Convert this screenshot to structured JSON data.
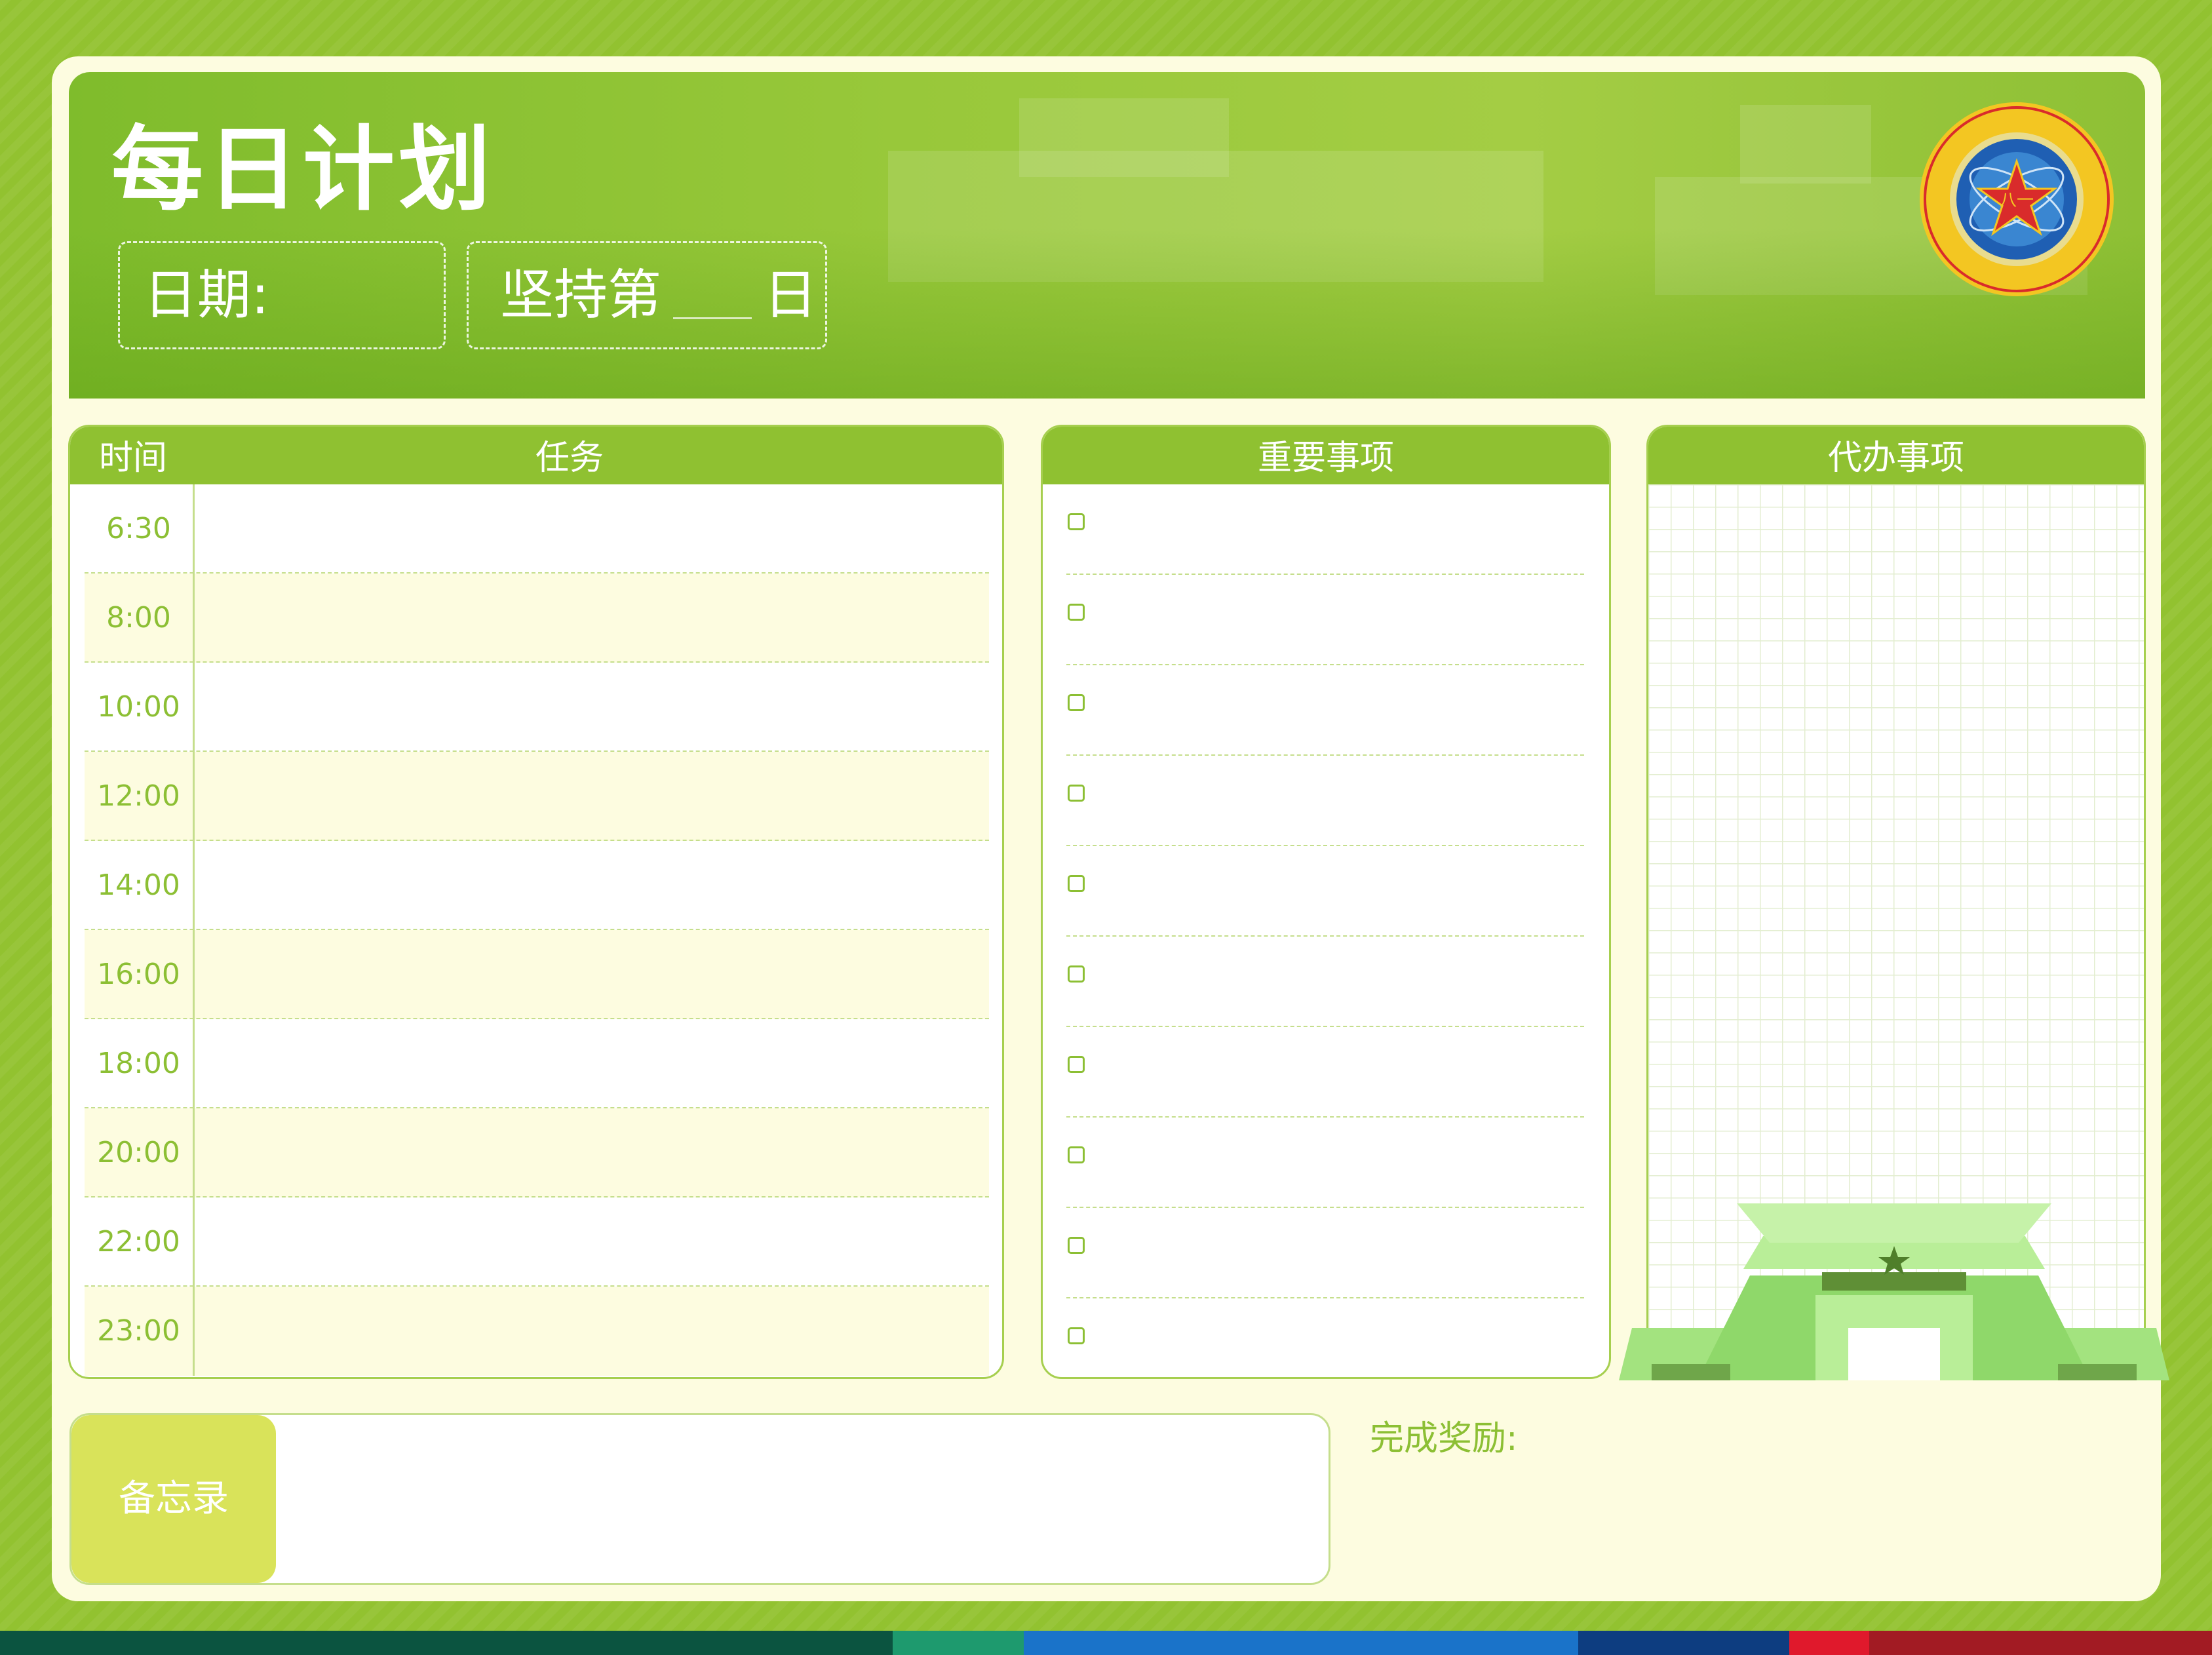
{
  "header": {
    "title": "每日计划",
    "date_label": "日期:",
    "persist_prefix": "坚持第",
    "persist_suffix": "日",
    "logo_icon": "nudt-emblem-icon"
  },
  "schedule": {
    "time_header": "时间",
    "task_header": "任务",
    "times": [
      "6:30",
      "8:00",
      "10:00",
      "12:00",
      "14:00",
      "16:00",
      "18:00",
      "20:00",
      "22:00",
      "23:00"
    ]
  },
  "important": {
    "header": "重要事项",
    "item_count_checkboxes": 10
  },
  "todo": {
    "header": "代办事项"
  },
  "memo": {
    "label": "备忘录"
  },
  "reward": {
    "label": "完成奖励:"
  },
  "colors": {
    "primary_green": "#8fc131",
    "page_bg": "#92c230",
    "sheet_bg": "#fdfce0",
    "memo_tab": "#d9e35a",
    "stripe": [
      "#0b5440",
      "#1e9a6e",
      "#1a73c9",
      "#0d3d80",
      "#e0192c",
      "#a21b23"
    ]
  }
}
